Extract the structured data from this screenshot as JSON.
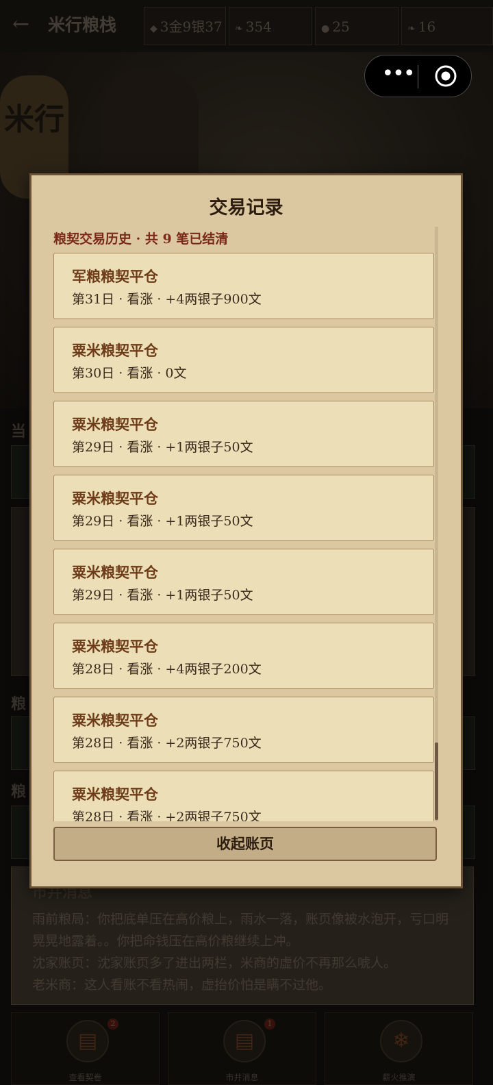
{
  "header": {
    "back_icon": "back-arrow-icon",
    "title": "米行粮栈",
    "stats": [
      {
        "icon": "ingot-icon",
        "value": "3金9银37"
      },
      {
        "icon": "grain-icon",
        "value": "354"
      },
      {
        "icon": "water-drop-icon",
        "value": "25"
      },
      {
        "icon": "grain-icon",
        "value": "16"
      }
    ]
  },
  "scene": {
    "sign_text": "米行"
  },
  "background": {
    "label_1": "当",
    "label_2": "粮",
    "label_3": "粮"
  },
  "news": {
    "title": "市井消息",
    "lines": [
      "雨前粮局：你把底单压在高价粮上，雨水一落，账页像被水泡开，亏口明晃晃地露着。。你把命钱压在高价粮继续上冲。",
      "沈家账页：沈家账页多了进出两栏，米商的虚价不再那么唬人。",
      "老米商：这人看账不看热闹，虚抬价怕是瞒不过他。"
    ]
  },
  "bottom_nav": [
    {
      "label": "查看契卷",
      "badge": "2",
      "icon": "scroll-icon"
    },
    {
      "label": "市井消息",
      "badge": "1",
      "icon": "scroll-icon"
    },
    {
      "label": "薪火推演",
      "badge": "",
      "icon": "flame-icon"
    }
  ],
  "modal": {
    "title": "交易记录",
    "subtitle": "粮契交易历史 · 共 9 笔已结清",
    "collapse_label": "收起账页",
    "records": [
      {
        "name": "军粮粮契平仓",
        "detail": "第31日 · 看涨 · +4两银子900文"
      },
      {
        "name": "粟米粮契平仓",
        "detail": "第30日 · 看涨 · 0文"
      },
      {
        "name": "粟米粮契平仓",
        "detail": "第29日 · 看涨 · +1两银子50文"
      },
      {
        "name": "粟米粮契平仓",
        "detail": "第29日 · 看涨 · +1两银子50文"
      },
      {
        "name": "粟米粮契平仓",
        "detail": "第29日 · 看涨 · +1两银子50文"
      },
      {
        "name": "粟米粮契平仓",
        "detail": "第28日 · 看涨 · +4两银子200文"
      },
      {
        "name": "粟米粮契平仓",
        "detail": "第28日 · 看涨 · +2两银子750文"
      },
      {
        "name": "粟米粮契平仓",
        "detail": "第28日 · 看涨 · +2两银子750文"
      }
    ]
  },
  "capsule": {
    "more_icon": "more-dots-icon",
    "close_icon": "record-circle-icon"
  }
}
